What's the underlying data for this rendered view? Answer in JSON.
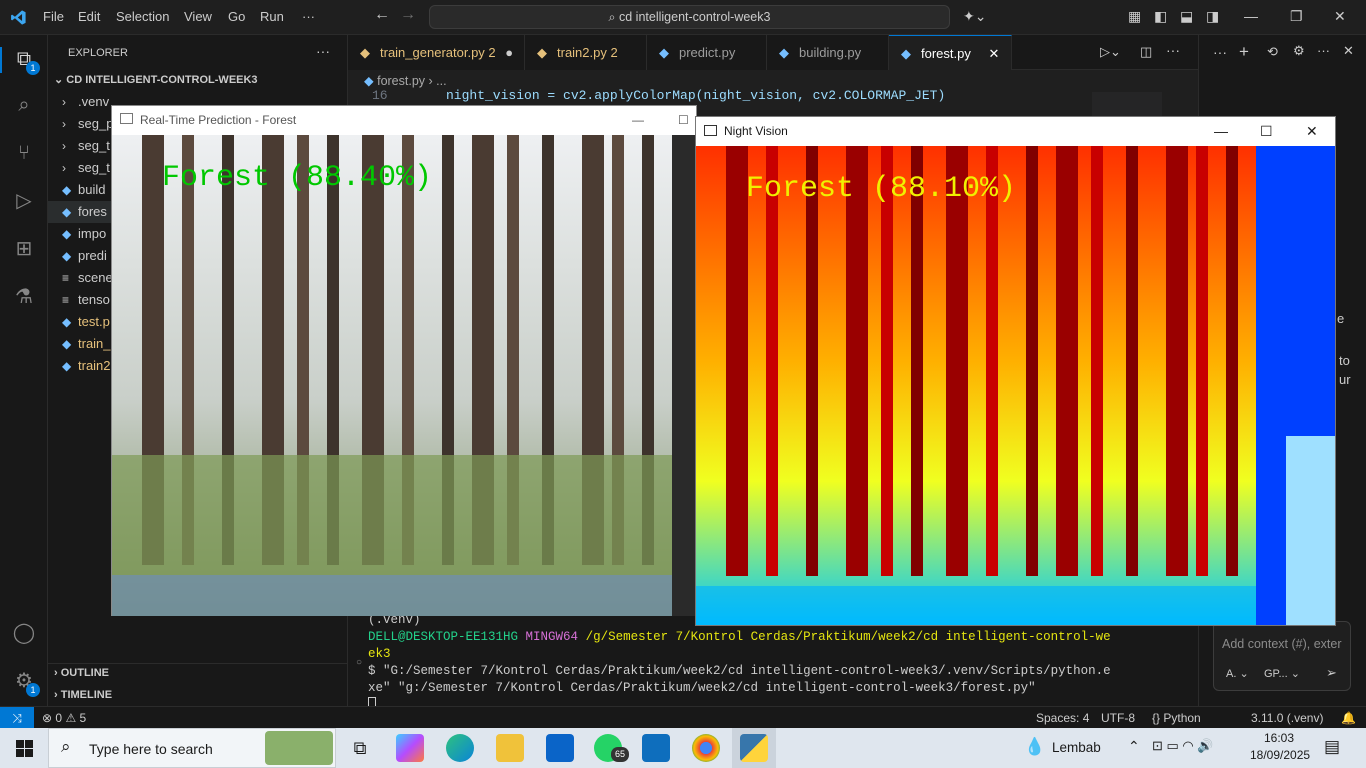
{
  "titlebar": {
    "menu": [
      "File",
      "Edit",
      "Selection",
      "View",
      "Go",
      "Run",
      "···"
    ],
    "search": "cd intelligent-control-week3"
  },
  "activity": {
    "explorer_badge": "1",
    "account_badge": "1"
  },
  "sidebar": {
    "title": "EXPLORER",
    "folder": "CD INTELLIGENT-CONTROL-WEEK3",
    "items": [
      {
        "label": ".venv",
        "kind": "folder"
      },
      {
        "label": "seg_p",
        "kind": "folder"
      },
      {
        "label": "seg_t",
        "kind": "folder"
      },
      {
        "label": "seg_t",
        "kind": "folder"
      },
      {
        "label": "build",
        "kind": "py"
      },
      {
        "label": "fores",
        "kind": "py"
      },
      {
        "label": "impo",
        "kind": "py"
      },
      {
        "label": "predi",
        "kind": "py"
      },
      {
        "label": "scene",
        "kind": "txt"
      },
      {
        "label": "tenso",
        "kind": "txt"
      },
      {
        "label": "test.p",
        "kind": "py-mod"
      },
      {
        "label": "train_",
        "kind": "py-mod"
      },
      {
        "label": "train2",
        "kind": "py-mod"
      }
    ],
    "outline": "OUTLINE",
    "timeline": "TIMELINE"
  },
  "tabs": [
    {
      "label": "train_generator.py",
      "badge": "2",
      "modified": true
    },
    {
      "label": "train2.py",
      "badge": "2",
      "modified": false
    },
    {
      "label": "predict.py",
      "badge": "",
      "modified": false
    },
    {
      "label": "building.py",
      "badge": "",
      "modified": false
    },
    {
      "label": "forest.py",
      "badge": "",
      "modified": false
    }
  ],
  "breadcrumb": {
    "file": "forest.py",
    "rest": "..."
  },
  "code": {
    "line_number": "16",
    "text": "night_vision = cv2.applyColorMap(night_vision, cv2.COLORMAP_JET)"
  },
  "terminal": {
    "venv": "(.venv)",
    "user": "DELL@DESKTOP-EE131HG",
    "shell": "MINGW64",
    "path1": "/g/Semester 7/Kontrol Cerdas/Praktikum/week2/cd intelligent-control-we",
    "path2": "ek3",
    "cmd1": "$ \"G:/Semester 7/Kontrol Cerdas/Praktikum/week2/cd intelligent-control-week3/.venv/Scripts/python.e",
    "cmd2": "xe\" \"g:/Semester 7/Kontrol Cerdas/Praktikum/week2/cd intelligent-control-week3/forest.py\""
  },
  "rightpanel": {
    "context_placeholder": "Add context (#), exter",
    "snip1": "e",
    "snip2": "to",
    "snip3": "ur",
    "mode": "A.",
    "model": "GP..."
  },
  "cv_window_1": {
    "title": "Real-Time Prediction - Forest",
    "overlay": "Forest (88.40%)",
    "overlay_color": "#00c800"
  },
  "cv_window_2": {
    "title": "Night Vision",
    "overlay": "Forest (88.10%)",
    "overlay_color": "#f0f000"
  },
  "statusbar": {
    "remote": "⤨",
    "errors": "0",
    "warnings": "5",
    "spaces": "Spaces: 4",
    "encoding": "UTF-8",
    "lang": "Python",
    "version": "3.11.0 (.venv)"
  },
  "taskbar": {
    "search": "Type here to search",
    "weather": "Lembab",
    "time": "16:03",
    "date": "18/09/2025",
    "whatsapp_badge": "65"
  }
}
